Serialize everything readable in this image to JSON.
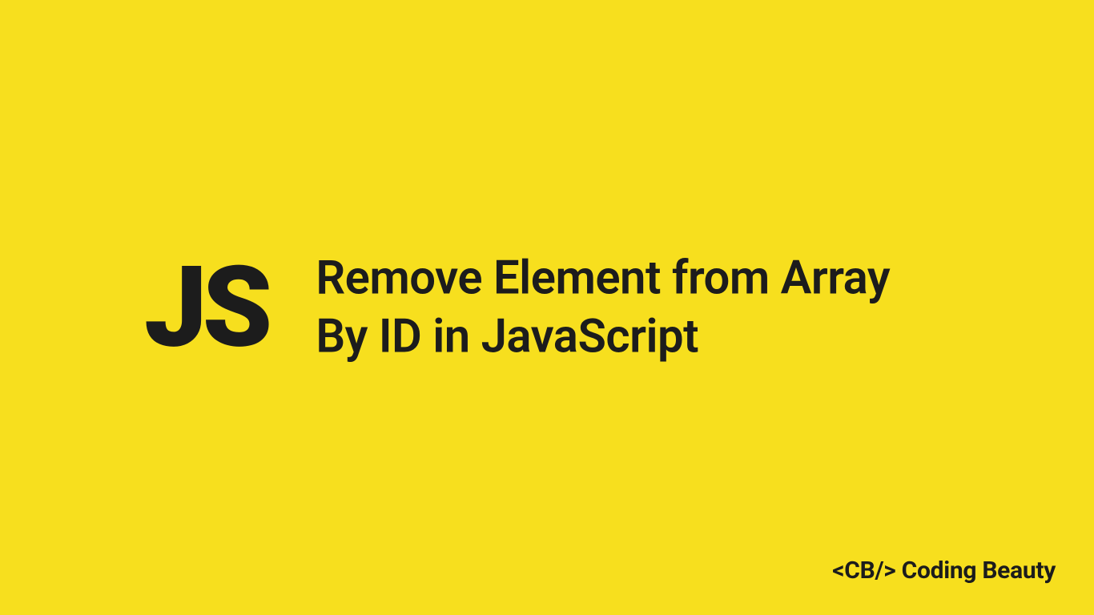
{
  "logo": {
    "text": "JS"
  },
  "title": {
    "text": "Remove Element from Array By ID in JavaScript"
  },
  "brand": {
    "text": "<CB/> Coding Beauty"
  },
  "colors": {
    "background": "#f7df1e",
    "foreground": "#1c1c1c"
  }
}
